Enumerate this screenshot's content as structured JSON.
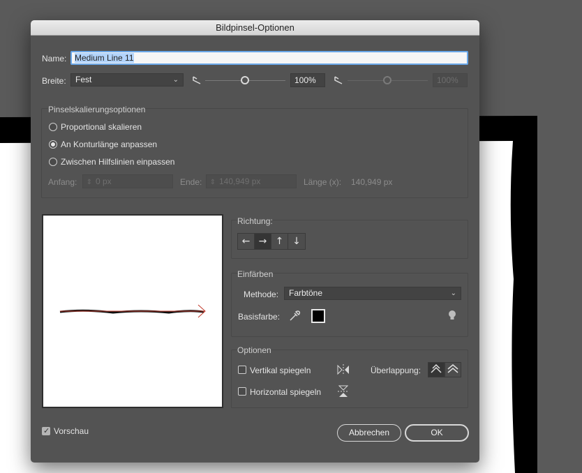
{
  "dialog": {
    "title": "Bildpinsel-Optionen",
    "name_label": "Name:",
    "name_value": "Medium Line 11",
    "width_label": "Breite:",
    "width_select": "Fest",
    "width_percent": "100%",
    "width_percent_disabled": "100%"
  },
  "scaling": {
    "title": "Pinselskalierungsoptionen",
    "options": [
      {
        "label": "Proportional skalieren",
        "selected": false
      },
      {
        "label": "An Konturlänge anpassen",
        "selected": true
      },
      {
        "label": "Zwischen Hilfslinien einpassen",
        "selected": false
      }
    ],
    "start_label": "Anfang:",
    "start_value": "0 px",
    "end_label": "Ende:",
    "end_value": "140,949 px",
    "length_label": "Länge (x):",
    "length_value": "140,949 px"
  },
  "direction": {
    "title": "Richtung:",
    "buttons": [
      "←",
      "→",
      "↑",
      "↓"
    ],
    "active_index": 1
  },
  "colorize": {
    "title": "Einfärben",
    "method_label": "Methode:",
    "method_value": "Farbtöne",
    "base_color_label": "Basisfarbe:",
    "base_color": "#000000"
  },
  "options": {
    "title": "Optionen",
    "flip_vertical": "Vertikal spiegeln",
    "flip_horizontal": "Horizontal spiegeln",
    "overlap_label": "Überlappung:"
  },
  "footer": {
    "preview_label": "Vorschau",
    "preview_checked": true,
    "cancel": "Abbrechen",
    "ok": "OK"
  },
  "colors": {
    "dialog_bg": "#535353",
    "focus_ring": "#6aa7e8",
    "stroke_accent": "#c0392b"
  }
}
